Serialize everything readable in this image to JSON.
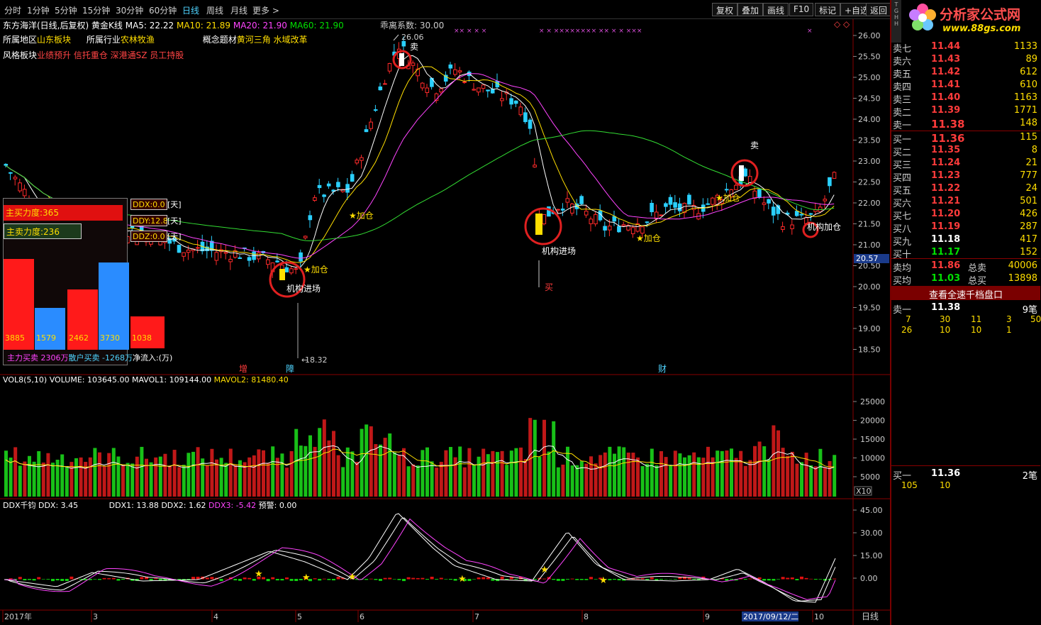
{
  "periods": [
    "分时",
    "1分钟",
    "5分钟",
    "15分钟",
    "30分钟",
    "60分钟",
    "日线",
    "周线",
    "月线",
    "更多 >"
  ],
  "toolbar": {
    "b1": "复权",
    "b2": "叠加",
    "b3": "画线",
    "b4": "F10",
    "b5": "标记",
    "b6": "+自选",
    "b7": "返回"
  },
  "stock": {
    "title": "东方海洋(日线,后复权)",
    "kline": "黄金K线",
    "ma5": "MA5: 22.22",
    "ma10": "MA10: 21.89",
    "ma20": "MA20: 21.90",
    "ma60": "MA60: 21.90",
    "bias": "乖离系数: 30.00"
  },
  "sector": {
    "region_label": "所属地区",
    "region": "山东板块",
    "industry_label": "所属行业",
    "industry": "农林牧渔",
    "concept_label": "概念题材",
    "concept": "黄河三角 水域改革",
    "style_label": "风格板块",
    "style": "业绩预升 信托重仓 深港通SZ 员工持股"
  },
  "marks": {
    "high": "26.06",
    "low": "18.32",
    "sell": "卖",
    "buy": "买",
    "add": "★加仓",
    "inst": "机构进场",
    "inst_add": "机构加仓",
    "zeng": "增",
    "zhang": "障",
    "cai": "财",
    "cur_price": "20.57"
  },
  "price_axis": [
    "26.00",
    "25.50",
    "25.00",
    "24.50",
    "24.00",
    "23.50",
    "23.00",
    "22.50",
    "22.00",
    "21.50",
    "21.00",
    "20.50",
    "20.00",
    "19.50",
    "19.00",
    "18.50"
  ],
  "ddx_panel": {
    "ddx": "DDX:0.0",
    "ddy": "DDY:12.8",
    "ddz": "DDZ:0.0",
    "day": "[天]",
    "zhumai": "主买力度:365",
    "zhumai2": "主卖力度:236",
    "bars": [
      "3885",
      "1579",
      "2462",
      "3730",
      "1038"
    ],
    "foot_a": "主力买卖 2306万",
    "foot_b": "散户买卖 -1268万",
    "foot_c": "净流入:(万)"
  },
  "vol": {
    "title": "VOL8(5,10)",
    "volume": "VOLUME: 103645.00",
    "mavol1": "MAVOL1: 109144.00",
    "mavol2": "MAVOL2: 81480.40",
    "axis": [
      "25000",
      "20000",
      "15000",
      "10000",
      "5000"
    ],
    "unit": "X10"
  },
  "ddxi": {
    "title": "DDX千钧",
    "ddx": "DDX: 3.45",
    "ddx1": "DDX1: 13.88",
    "ddx2": "DDX2: 1.62",
    "ddx3": "DDX3: -5.42",
    "warn": "预警: 0.00",
    "axis": [
      "45.00",
      "30.00",
      "15.00",
      "0.00"
    ]
  },
  "timeaxis": {
    "labels": [
      "2017年",
      "3",
      "4",
      "5",
      "6",
      "7",
      "8",
      "9",
      "10"
    ],
    "cursor": "2017/09/12/二",
    "mode": "日线"
  },
  "logo": {
    "title": "分析家公式网",
    "url": "www.88gs.com"
  },
  "orderbook": {
    "sell": [
      {
        "l": "卖七",
        "p": "11.44",
        "v": "1133"
      },
      {
        "l": "卖六",
        "p": "11.43",
        "v": "89"
      },
      {
        "l": "卖五",
        "p": "11.42",
        "v": "612"
      },
      {
        "l": "卖四",
        "p": "11.41",
        "v": "610"
      },
      {
        "l": "卖三",
        "p": "11.40",
        "v": "1163"
      },
      {
        "l": "卖二",
        "p": "11.39",
        "v": "1771"
      },
      {
        "l": "卖一",
        "p": "11.38",
        "v": "148"
      }
    ],
    "buy": [
      {
        "l": "买一",
        "p": "11.36",
        "v": "115"
      },
      {
        "l": "买二",
        "p": "11.35",
        "v": "8"
      },
      {
        "l": "买三",
        "p": "11.24",
        "v": "21"
      },
      {
        "l": "买四",
        "p": "11.23",
        "v": "777"
      },
      {
        "l": "买五",
        "p": "11.22",
        "v": "24"
      },
      {
        "l": "买六",
        "p": "11.21",
        "v": "501"
      },
      {
        "l": "买七",
        "p": "11.20",
        "v": "426"
      },
      {
        "l": "买八",
        "p": "11.19",
        "v": "287"
      },
      {
        "l": "买九",
        "p": "11.18",
        "v": "417"
      },
      {
        "l": "买十",
        "p": "11.17",
        "v": "152"
      }
    ],
    "avg_sell_l": "卖均",
    "avg_sell_p": "11.86",
    "total_sell_l": "总卖",
    "total_sell_v": "40006",
    "avg_buy_l": "买均",
    "avg_buy_p": "11.03",
    "total_buy_l": "总买",
    "total_buy_v": "13898",
    "view_btn": "查看全速千档盘口",
    "s1_label": "卖一",
    "s1_price": "11.38",
    "s1_count": "9笔",
    "s1_q1": [
      "7",
      "30",
      "11",
      "3",
      "50"
    ],
    "s1_q2": [
      "26",
      "10",
      "10",
      "1"
    ],
    "b1_label": "买一",
    "b1_price": "11.36",
    "b1_count": "2笔",
    "b1_q": [
      "105",
      "10"
    ]
  }
}
